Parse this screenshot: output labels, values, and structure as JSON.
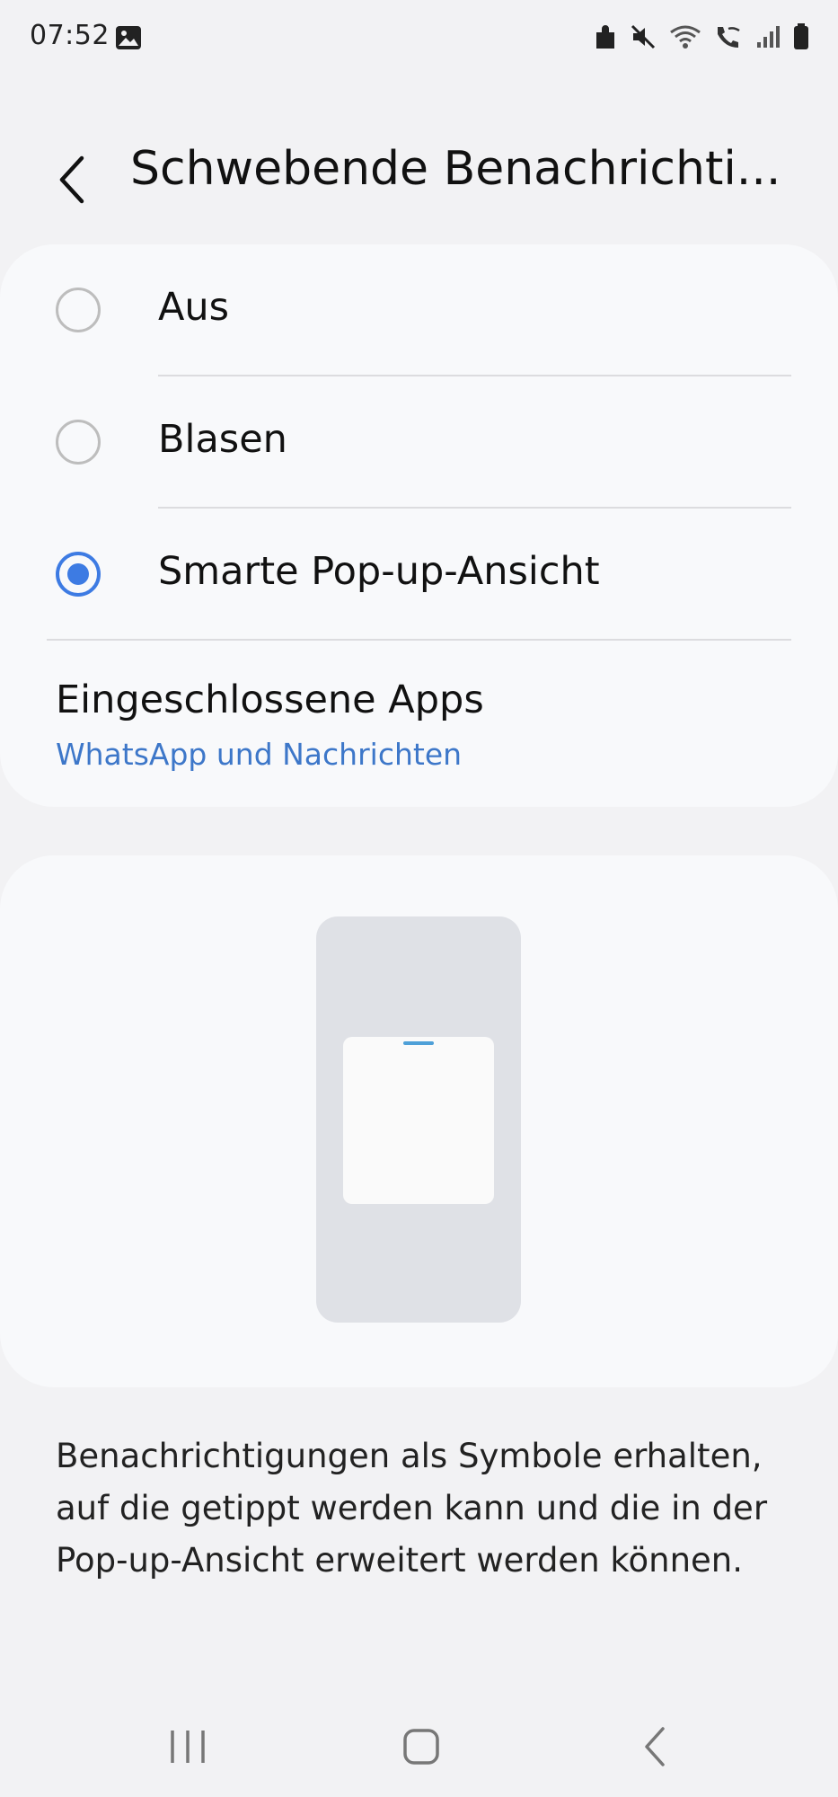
{
  "status_bar": {
    "time": "07:52",
    "icons": [
      "gallery-icon",
      "puzzle-icon",
      "mute-icon",
      "wifi-icon",
      "wifi-calling-icon",
      "signal-icon",
      "battery-icon"
    ]
  },
  "header": {
    "title": "Schwebende Benachrichti...",
    "back_icon": "chevron-left-icon"
  },
  "options": [
    {
      "label": "Aus",
      "selected": false
    },
    {
      "label": "Blasen",
      "selected": false
    },
    {
      "label": "Smarte Pop-up-Ansicht",
      "selected": true
    }
  ],
  "included_apps": {
    "title": "Eingeschlossene Apps",
    "value": "WhatsApp und Nachrichten"
  },
  "description": "Benachrichtigungen als Symbole erhalten, auf die getippt werden kann und die in der Pop-up-Ansicht erweitert werden können.",
  "nav_bar": {
    "icons": [
      "recents-icon",
      "home-icon",
      "back-icon"
    ]
  },
  "colors": {
    "accent": "#3d7be3",
    "link": "#3d77c9",
    "background": "#f2f2f4",
    "card": "#f8f9fb"
  }
}
